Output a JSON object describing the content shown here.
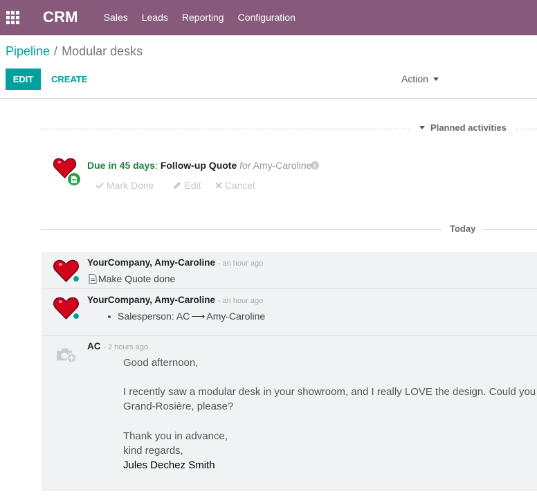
{
  "navbar": {
    "brand": "CRM",
    "menu": [
      "Sales",
      "Leads",
      "Reporting",
      "Configuration"
    ]
  },
  "breadcrumb": {
    "parent": "Pipeline",
    "separator": "/",
    "current": "Modular desks"
  },
  "buttons": {
    "edit": "EDIT",
    "create": "CREATE",
    "action": "Action"
  },
  "planned": {
    "title": "Planned activities",
    "activity": {
      "due": "Due in 45 days",
      "colon": ":",
      "type": "Follow-up Quote",
      "for": "for",
      "user": "Amy-Caroline",
      "mark_done": "Mark Done",
      "edit": "Edit",
      "cancel": "Cancel"
    }
  },
  "today_label": "Today",
  "messages": [
    {
      "author": "YourCompany, Amy-Caroline",
      "time": "- an hour ago",
      "body": "Make Quote done"
    },
    {
      "author": "YourCompany, Amy-Caroline",
      "time": "- an hour ago",
      "field": "Salesperson: AC",
      "arrow": "⟶",
      "new_value": "Amy-Caroline"
    },
    {
      "author": "AC",
      "time": "- 2 hours ago",
      "lines": [
        "Good afternoon,",
        "I recently saw a modular desk in your showroom, and I really LOVE the design. Could you",
        "Grand-Rosière, please?",
        "Thank you in advance,",
        "kind regards,",
        "Jules Dechez Smith"
      ]
    }
  ],
  "colors": {
    "navbar": "#875a7b",
    "accent": "#00a09d",
    "due_green": "#20803f",
    "activity_badge": "#28a745",
    "message_bg": "#f0f2f4"
  },
  "icons": {
    "apps": "apps-grid-icon",
    "avatar": "heart-avatar",
    "activity_type": "document-icon",
    "info": "info-icon",
    "check": "check-icon",
    "pencil": "pencil-icon",
    "times": "times-icon",
    "file": "file-icon",
    "camera": "camera-placeholder-icon"
  }
}
